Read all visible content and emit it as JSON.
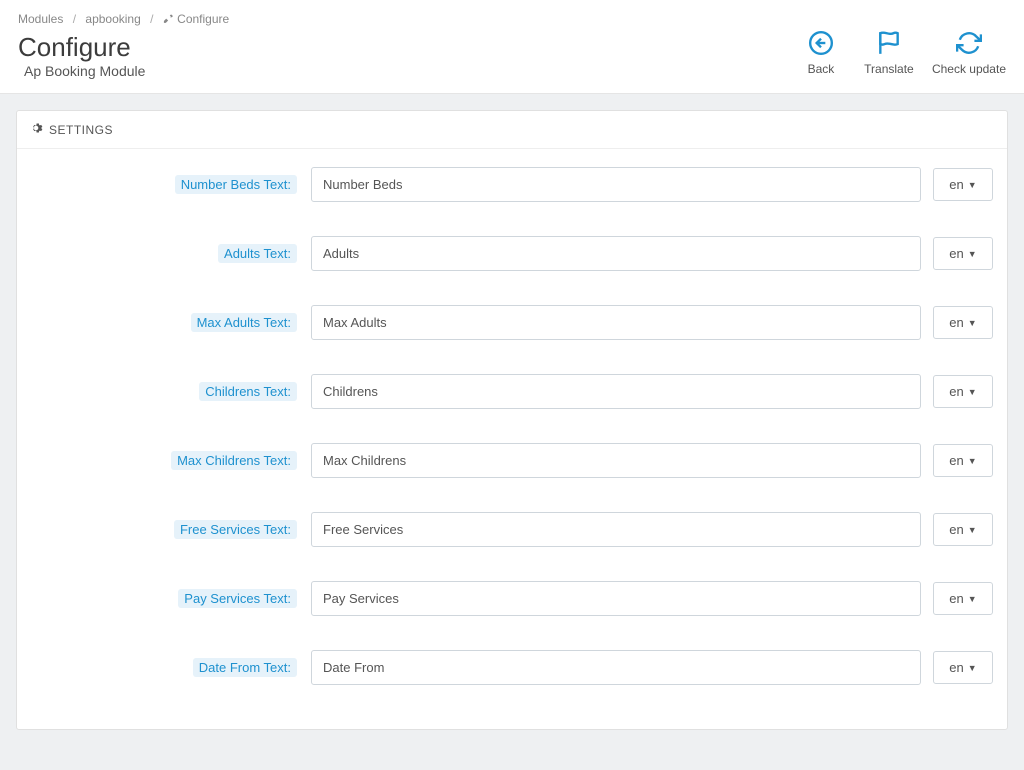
{
  "breadcrumb": {
    "modules": "Modules",
    "ap": "apbooking",
    "current": "Configure"
  },
  "header": {
    "title": "Configure",
    "subtitle": "Ap Booking Module"
  },
  "toolbar": {
    "back": "Back",
    "translate": "Translate",
    "check_update": "Check update"
  },
  "panel": {
    "title": "SETTINGS"
  },
  "lang": "en",
  "fields": {
    "number_beds": {
      "label": "Number Beds Text:",
      "value": "Number Beds"
    },
    "adults": {
      "label": "Adults Text:",
      "value": "Adults"
    },
    "max_adults": {
      "label": "Max Adults Text:",
      "value": "Max Adults"
    },
    "childrens": {
      "label": "Childrens Text:",
      "value": "Childrens"
    },
    "max_childrens": {
      "label": "Max Childrens Text:",
      "value": "Max Childrens"
    },
    "free_services": {
      "label": "Free Services Text:",
      "value": "Free Services"
    },
    "pay_services": {
      "label": "Pay Services Text:",
      "value": "Pay Services"
    },
    "date_from": {
      "label": "Date From Text:",
      "value": "Date From"
    }
  }
}
